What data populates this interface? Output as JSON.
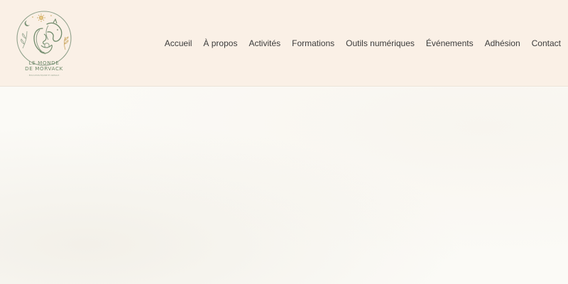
{
  "header": {
    "logo": {
      "line1": "LE MONDE",
      "line2": "DE MORVACK",
      "tagline": "· ÉDUCATION ÉQUINE ET ANIMALE ·",
      "icon": "horse-woman-emblem-icon"
    },
    "nav": [
      {
        "label": "Accueil"
      },
      {
        "label": "À propos"
      },
      {
        "label": "Activités"
      },
      {
        "label": "Formations"
      },
      {
        "label": "Outils numériques"
      },
      {
        "label": "Événements"
      },
      {
        "label": "Adhésion"
      },
      {
        "label": "Contact"
      }
    ]
  },
  "colors": {
    "header_bg": "#faf0e6",
    "page_bg": "#fbfaf6",
    "logo_green": "#6f8a6a",
    "logo_gold": "#c9a45c",
    "nav_text": "#3b3b3b"
  }
}
